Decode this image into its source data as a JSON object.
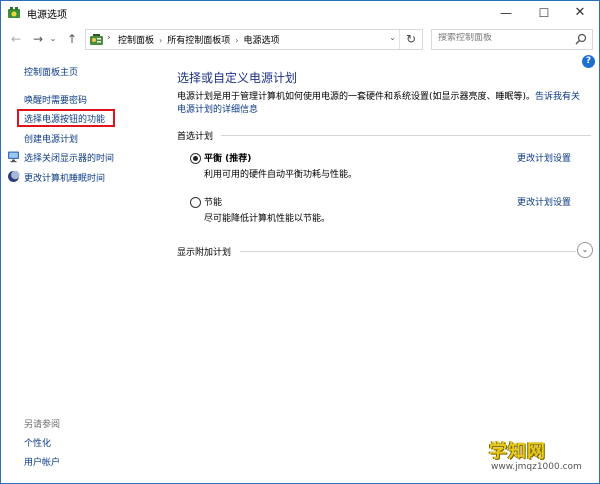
{
  "window": {
    "title": "电源选项",
    "minimize_glyph": "—",
    "maximize_glyph": "☐",
    "close_glyph": "✕"
  },
  "navigation": {
    "back_glyph": "←",
    "forward_glyph": "→",
    "recent_glyph": "⌄",
    "up_glyph": "↑",
    "breadcrumbs": [
      "控制面板",
      "所有控制面板项",
      "电源选项"
    ],
    "separator_glyph": "›",
    "refresh_glyph": "↻"
  },
  "search": {
    "placeholder": "搜索控制面板"
  },
  "left_pane": {
    "home": "控制面板主页",
    "items": [
      {
        "label": "唤醒时需要密码",
        "icon": null
      },
      {
        "label": "选择电源按钮的功能",
        "icon": null,
        "highlighted": true
      },
      {
        "label": "创建电源计划",
        "icon": null
      },
      {
        "label": "选择关闭显示器的时间",
        "icon": "monitor-icon"
      },
      {
        "label": "更改计算机睡眠时间",
        "icon": "moon-icon"
      }
    ],
    "see_also": {
      "title": "另请参阅",
      "items": [
        "个性化",
        "用户帐户"
      ]
    }
  },
  "main": {
    "title": "选择或自定义电源计划",
    "description": "电源计划是用于管理计算机如何使用电源的一套硬件和系统设置(如显示器亮度、睡眠等)。",
    "description_link": "告诉我有关电源计划的详细信息",
    "preferred_title": "首选计划",
    "plans": [
      {
        "name": "平衡 (推荐)",
        "description": "利用可用的硬件自动平衡功耗与性能。",
        "link": "更改计划设置",
        "selected": true
      },
      {
        "name": "节能",
        "description": "尽可能降低计算机性能以节能。",
        "link": "更改计划设置",
        "selected": false
      }
    ],
    "extra_plans": "显示附加计划",
    "expand_glyph": "⌄",
    "help_glyph": "?"
  },
  "watermark": {
    "main": "学知网",
    "sub": "www.jmqz1000.com"
  },
  "colors": {
    "link": "#0b3a86",
    "title": "#1e3287",
    "highlight_border": "#e1141b",
    "window_border": "#2b6fbd"
  }
}
